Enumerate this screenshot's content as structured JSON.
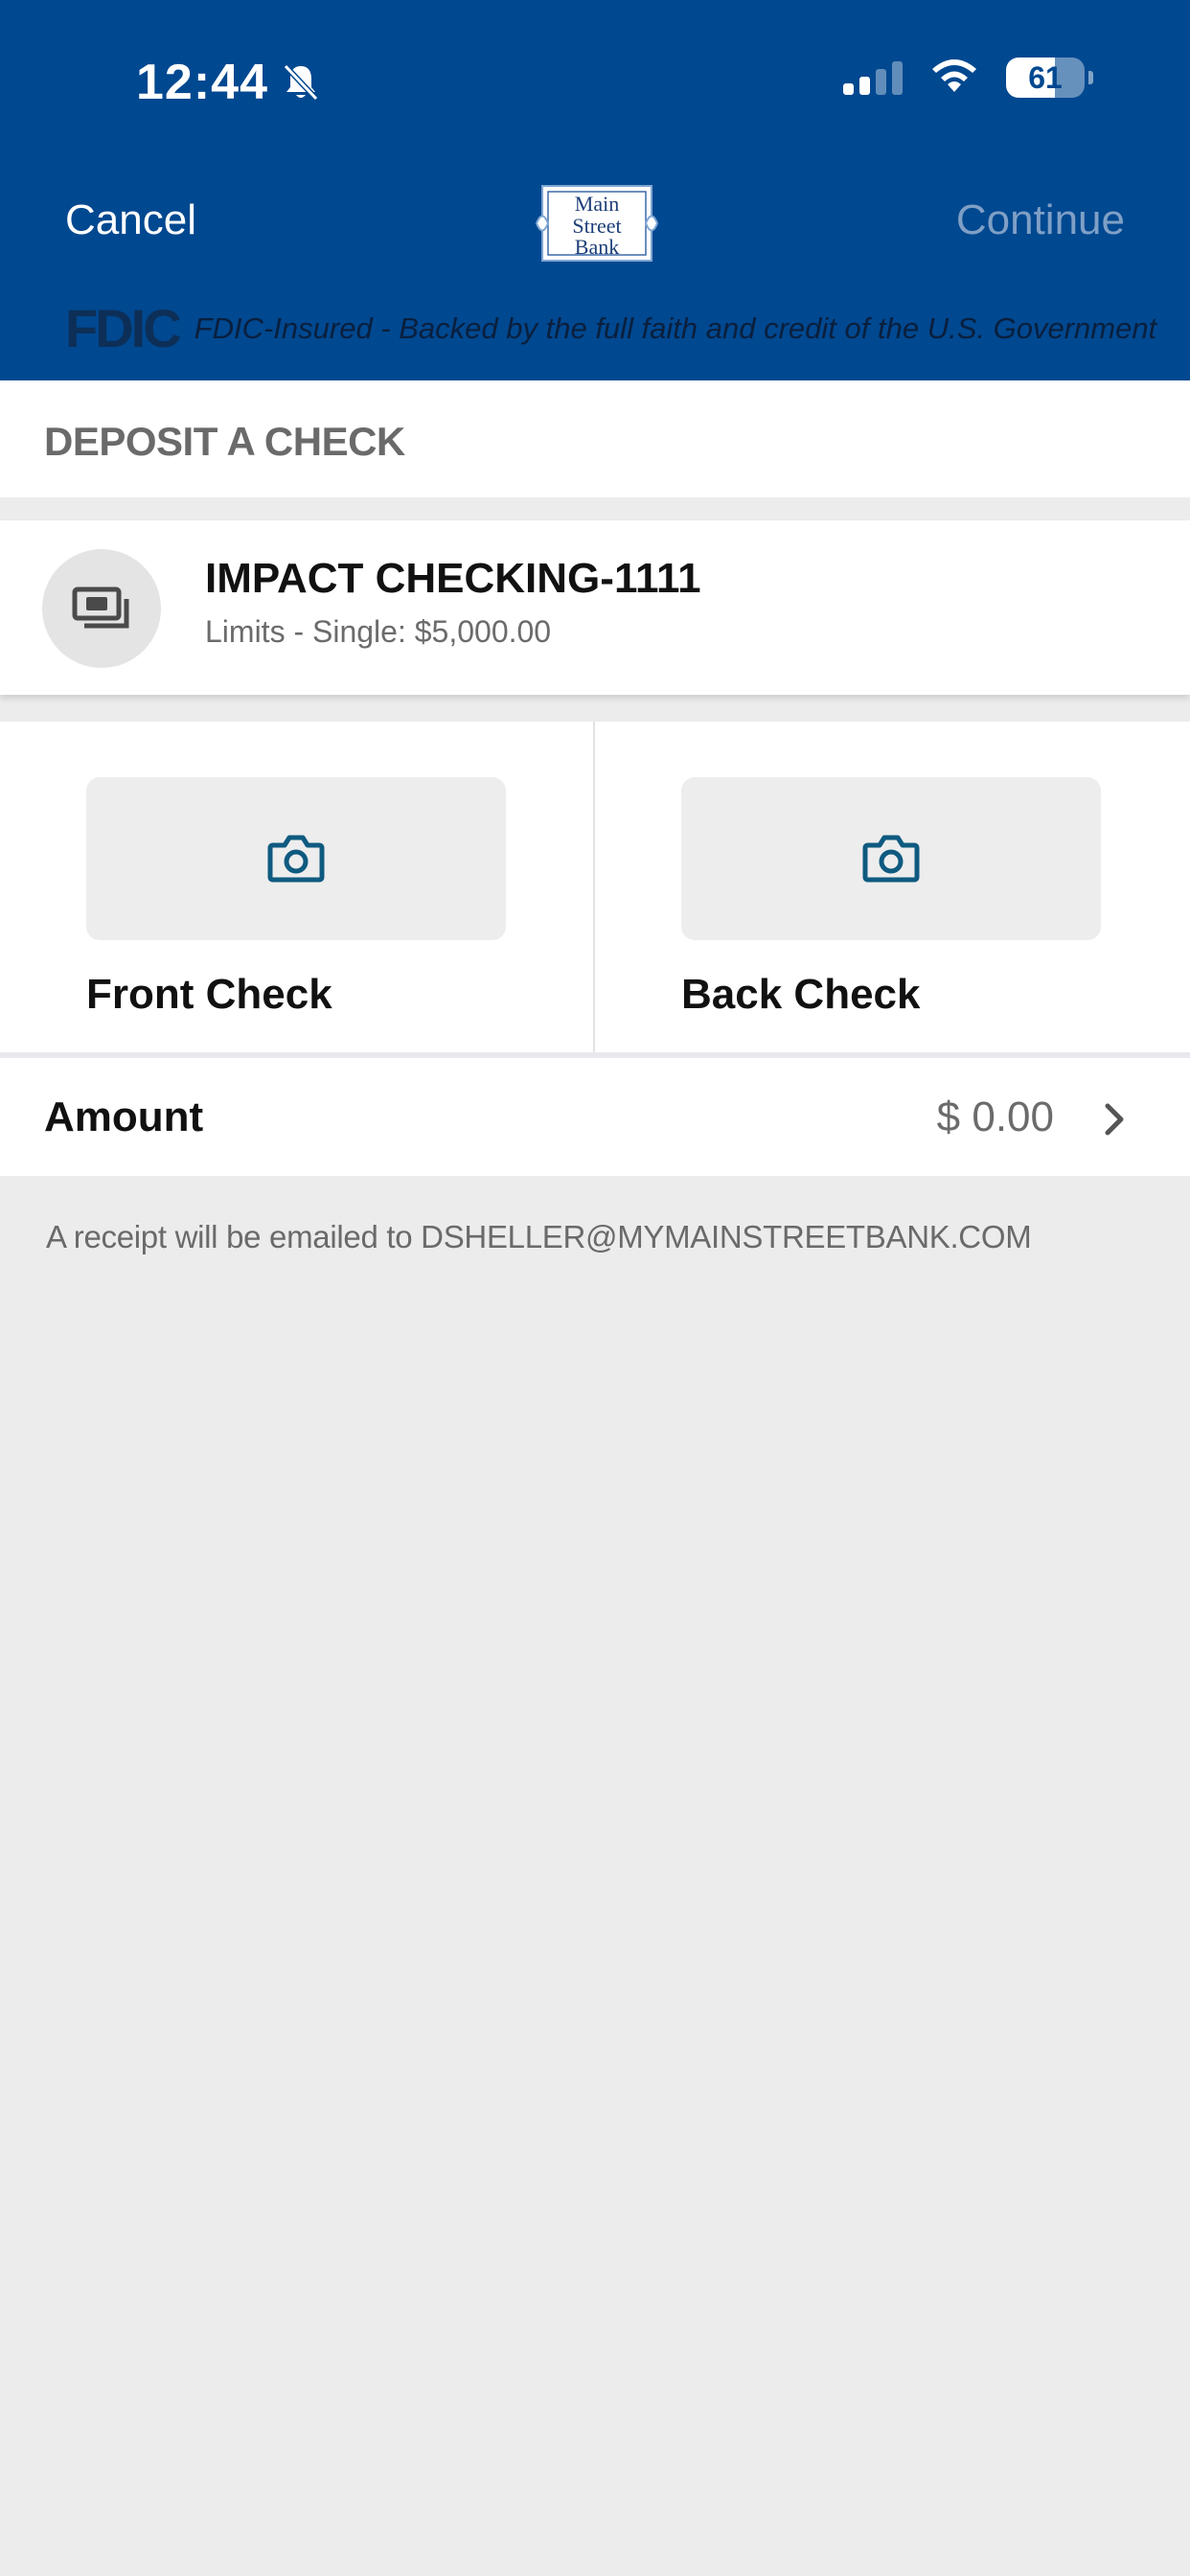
{
  "status_bar": {
    "time": "12:44",
    "battery": "61"
  },
  "nav": {
    "cancel_label": "Cancel",
    "continue_label": "Continue",
    "logo_lines": [
      "Main",
      "Street",
      "Bank"
    ]
  },
  "fdic": {
    "logo_text": "FDIC",
    "notice": "FDIC-Insured - Backed by the full faith and credit of the U.S. Government"
  },
  "page": {
    "title": "DEPOSIT A CHECK"
  },
  "account": {
    "name": "IMPACT CHECKING-1111",
    "limits": "Limits - Single: $5,000.00",
    "icon": "cash-icon"
  },
  "capture": {
    "front_label": "Front Check",
    "back_label": "Back Check",
    "icon": "camera-icon"
  },
  "amount": {
    "label": "Amount",
    "value": "$ 0.00"
  },
  "receipt_note": "A receipt will be emailed to DSHELLER@MYMAINSTREETBANK.COM",
  "colors": {
    "header_bg": "#004890",
    "accent_icon": "#0f5a80",
    "continue_disabled": "#7f9fc6"
  }
}
